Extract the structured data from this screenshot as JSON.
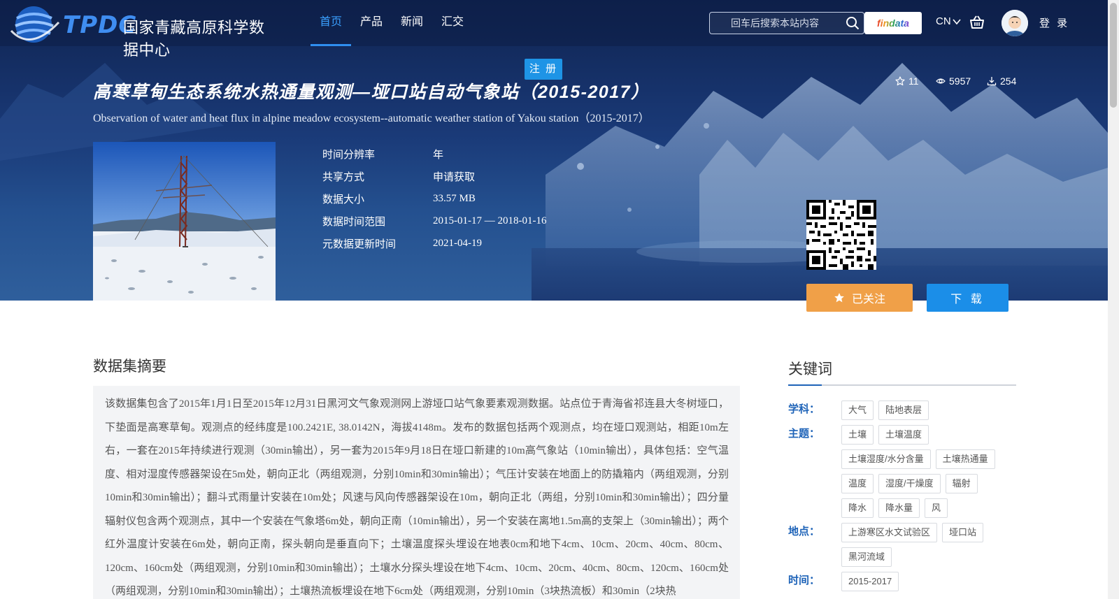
{
  "header": {
    "logo_abbr": "TPDC",
    "logo_name": "国家青藏高原科学数据中心",
    "nav": [
      {
        "label": "首页",
        "active": true
      },
      {
        "label": "产品",
        "active": false
      },
      {
        "label": "新闻",
        "active": false
      },
      {
        "label": "汇交",
        "active": false
      }
    ],
    "search_placeholder": "回车后搜索本站内容",
    "findata_label": "findata",
    "lang_label": "CN",
    "login_label": "登 录",
    "register_label": "注 册"
  },
  "dataset": {
    "title_cn": "高寒草甸生态系统水热通量观测—垭口站自动气象站（2015-2017）",
    "title_en": "Observation of water and heat flux in alpine meadow ecosystem--automatic weather station of Yakou station（2015-2017）",
    "stars": "11",
    "views": "5957",
    "downloads": "254",
    "meta": [
      {
        "key": "时间分辨率",
        "value": "年"
      },
      {
        "key": "共享方式",
        "value": "申请获取"
      },
      {
        "key": "数据大小",
        "value": "33.57 MB"
      },
      {
        "key": "数据时间范围",
        "value": "2015-01-17 — 2018-01-16"
      },
      {
        "key": "元数据更新时间",
        "value": "2021-04-19"
      }
    ],
    "follow_label": "已关注",
    "download_label": "下 载"
  },
  "abstract": {
    "title": "数据集摘要",
    "text": "该数据集包含了2015年1月1日至2015年12月31日黑河文气象观测网上游垭口站气象要素观测数据。站点位于青海省祁连县大冬树垭口，下垫面是高寒草甸。观测点的经纬度是100.2421E, 38.0142N，海拔4148m。发布的数据包括两个观测点，均在垭口观测站，相距10m左右，一套在2015年持续进行观测（30min输出），另一套为2015年9月18日在垭口新建的10m高气象站（10min输出），具体包括：空气温度、相对湿度传感器架设在5m处，朝向正北（两组观测，分别10min和30min输出）；气压计安装在地面上的防撬箱内（两组观测，分别10min和30min输出）；翻斗式雨量计安装在10m处；风速与风向传感器架设在10m，朝向正北（两组，分别10min和30min输出）；四分量辐射仪包含两个观测点，其中一个安装在气象塔6m处，朝向正南（10min输出），另一个安装在离地1.5m高的支架上（30min输出）；两个红外温度计安装在6m处，朝向正南，探头朝向是垂直向下；土壤温度探头埋设在地表0cm和地下4cm、10cm、20cm、40cm、80cm、120cm、160cm处（两组观测，分别10min和30min输出）；土壤水分探头埋设在地下4cm、10cm、20cm、40cm、80cm、120cm、160cm处（两组观测，分别10min和30min输出）；土壤热流板埋设在地下6cm处（两组观测，分别10min（3块热流板）和30min（2块热"
  },
  "keywords": {
    "title": "关键词",
    "groups": [
      {
        "label": "学科：",
        "tags": [
          "大气",
          "陆地表层"
        ]
      },
      {
        "label": "主题：",
        "tags": [
          "土壤",
          "土壤温度",
          "土壤湿度/水分含量",
          "土壤热通量",
          "温度",
          "湿度/干燥度",
          "辐射",
          "降水",
          "降水量",
          "风"
        ]
      },
      {
        "label": "地点：",
        "tags": [
          "上游寒区水文试验区",
          "垭口站",
          "黑河流域"
        ]
      },
      {
        "label": "时间：",
        "tags": [
          "2015-2017"
        ]
      }
    ]
  },
  "colors": {
    "accent": "#2f8ff0",
    "follow": "#f0a048",
    "download": "#1b8ee8",
    "keyword_label": "#1e63b8"
  },
  "icons": [
    "globe-logo-icon",
    "search-icon",
    "chevron-down-icon",
    "cart-icon",
    "user-avatar-icon",
    "star-outline-icon",
    "eye-icon",
    "download-icon",
    "qr-code-icon",
    "star-filled-icon"
  ]
}
